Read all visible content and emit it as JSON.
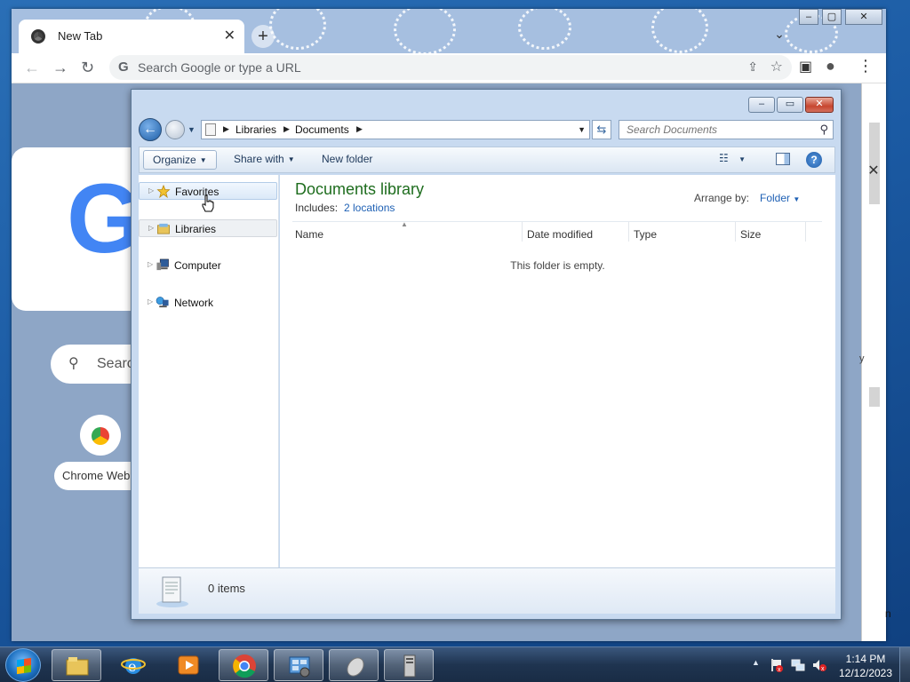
{
  "chrome": {
    "tab_title": "New Tab",
    "tab_close": "✕",
    "new_tab": "+",
    "omnibox_placeholder": "Search Google or type a URL",
    "ntp_logo_letter": "G",
    "ntp_search_placeholder": "Search",
    "shortcut_label": "Chrome Web Store",
    "side_label_y": "y",
    "side_label_n": "n"
  },
  "explorer": {
    "breadcrumbs": [
      "Libraries",
      "Documents"
    ],
    "search_placeholder": "Search Documents",
    "commands": {
      "organize": "Organize",
      "share_with": "Share with",
      "new_folder": "New folder"
    },
    "nav": {
      "favorites": "Favorites",
      "libraries": "Libraries",
      "computer": "Computer",
      "network": "Network"
    },
    "library_title": "Documents library",
    "includes_label": "Includes:",
    "locations_link": "2 locations",
    "arrange_label": "Arrange by:",
    "arrange_value": "Folder",
    "columns": [
      "Name",
      "Date modified",
      "Type",
      "Size"
    ],
    "empty_message": "This folder is empty.",
    "items_count": "0 items"
  },
  "taskbar": {
    "clock_time": "1:14 PM",
    "clock_date": "12/12/2023"
  },
  "colors": {
    "library_title": "#1e6d1e",
    "link": "#1e60b4",
    "google_blue": "#4285f4"
  }
}
